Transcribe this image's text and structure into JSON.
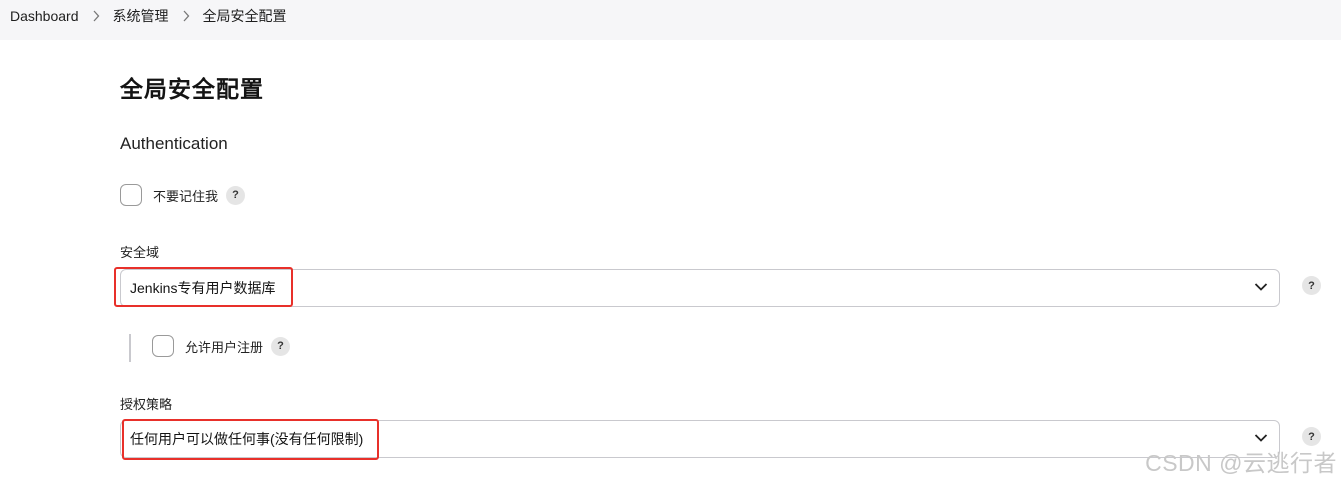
{
  "breadcrumb": {
    "items": [
      {
        "label": "Dashboard"
      },
      {
        "label": "系统管理"
      },
      {
        "label": "全局安全配置"
      }
    ]
  },
  "page": {
    "title": "全局安全配置",
    "section_title": "Authentication"
  },
  "remember_me": {
    "label": "不要记住我",
    "checked": false,
    "help": "?"
  },
  "security_realm": {
    "label": "安全域",
    "value": "Jenkins专有用户数据库",
    "help": "?"
  },
  "allow_signup": {
    "label": "允许用户注册",
    "checked": false,
    "help": "?"
  },
  "authorization": {
    "label": "授权策略",
    "value": "任何用户可以做任何事(没有任何限制)",
    "help": "?"
  },
  "watermark": "CSDN @云逃行者",
  "colors": {
    "highlight": "#e8302a",
    "breadcrumb_bg": "#f6f6f8",
    "select_border": "#c9c9ce"
  }
}
